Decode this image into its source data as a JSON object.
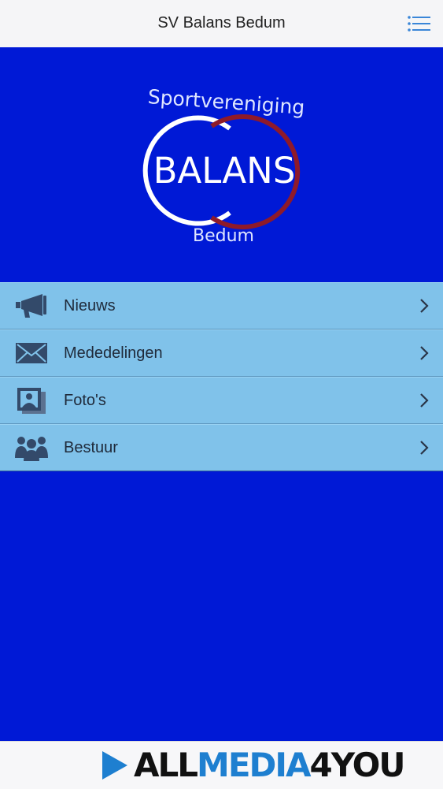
{
  "header": {
    "title": "SV Balans Bedum",
    "menu_icon": "hamburger-menu-icon"
  },
  "logo": {
    "top_text": "Sportvereniging",
    "main_text": "BALANS",
    "bottom_text": "Bedum",
    "colors": {
      "left_ring": "#ffffff",
      "right_ring": "#8e1a2a"
    }
  },
  "menu": {
    "items": [
      {
        "label": "Nieuws",
        "icon": "megaphone-icon"
      },
      {
        "label": "Mededelingen",
        "icon": "envelope-icon"
      },
      {
        "label": "Foto's",
        "icon": "photos-icon"
      },
      {
        "label": "Bestuur",
        "icon": "people-icon"
      }
    ]
  },
  "footer": {
    "brand_part1": "ALL",
    "brand_part2": "MEDIA",
    "brand_part3": "4YOU"
  },
  "colors": {
    "background": "#0019d6",
    "menu": "#80c2ea",
    "accent": "#1e7fd0"
  }
}
